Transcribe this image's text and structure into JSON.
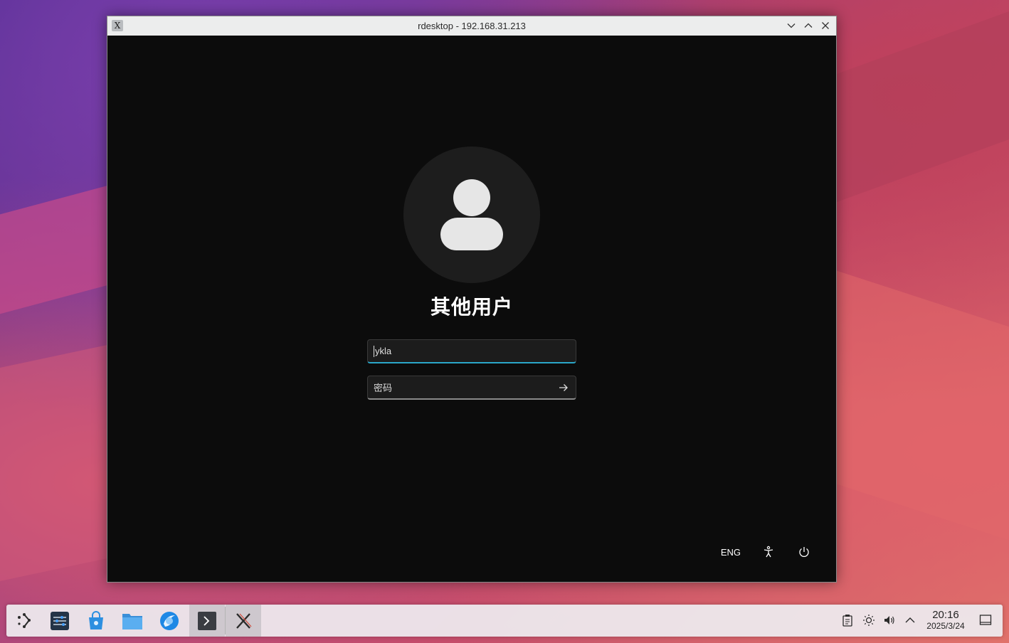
{
  "window": {
    "title": "rdesktop - 192.168.31.213",
    "app_icon": "X",
    "buttons": [
      "minimize-icon",
      "maximize-icon",
      "close-icon"
    ]
  },
  "login": {
    "display_name": "其他用户",
    "username_value": "ykla",
    "password_placeholder": "密码",
    "language": "ENG"
  },
  "taskbar": {
    "apps": [
      "application-launcher-icon",
      "system-settings-icon",
      "discover-store-icon",
      "file-manager-icon",
      "browser-icon",
      "terminal-icon",
      "rdesktop-icon"
    ],
    "tray": [
      "clipboard-icon",
      "brightness-icon",
      "volume-icon",
      "show-hidden-icons-chevron"
    ],
    "clock_time": "20:16",
    "clock_date": "2025/3/24"
  }
}
